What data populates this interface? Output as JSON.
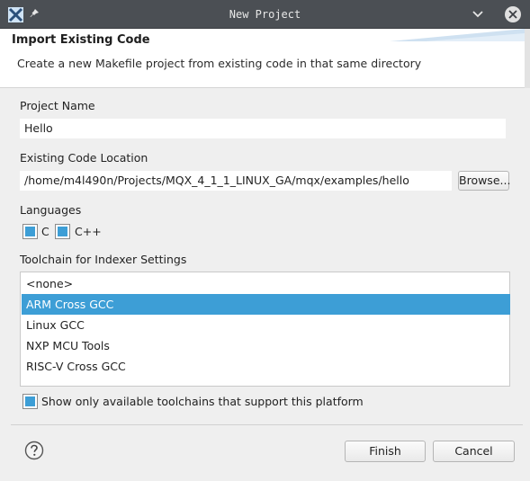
{
  "window": {
    "title": "New Project"
  },
  "header": {
    "title": "Import Existing Code",
    "description": "Create a new Makefile project from existing code in that same directory"
  },
  "project_name": {
    "label": "Project Name",
    "value": "Hello"
  },
  "code_location": {
    "label": "Existing Code Location",
    "value": "/home/m4l490n/Projects/MQX_4_1_1_LINUX_GA/mqx/examples/hello",
    "browse_label": "Browse..."
  },
  "languages": {
    "label": "Languages",
    "items": [
      {
        "label": "C",
        "checked": true
      },
      {
        "label": "C++",
        "checked": true
      }
    ]
  },
  "toolchain": {
    "label": "Toolchain for Indexer Settings",
    "items": [
      "<none>",
      "ARM Cross GCC",
      "Linux GCC",
      "NXP MCU Tools",
      "RISC-V Cross GCC"
    ],
    "selected": "ARM Cross GCC",
    "show_only_label": "Show only available toolchains that support this platform",
    "show_only_checked": true
  },
  "footer": {
    "finish_label": "Finish",
    "cancel_label": "Cancel"
  },
  "colors": {
    "accent": "#3d9ed6",
    "titlebar": "#4b4f54"
  }
}
